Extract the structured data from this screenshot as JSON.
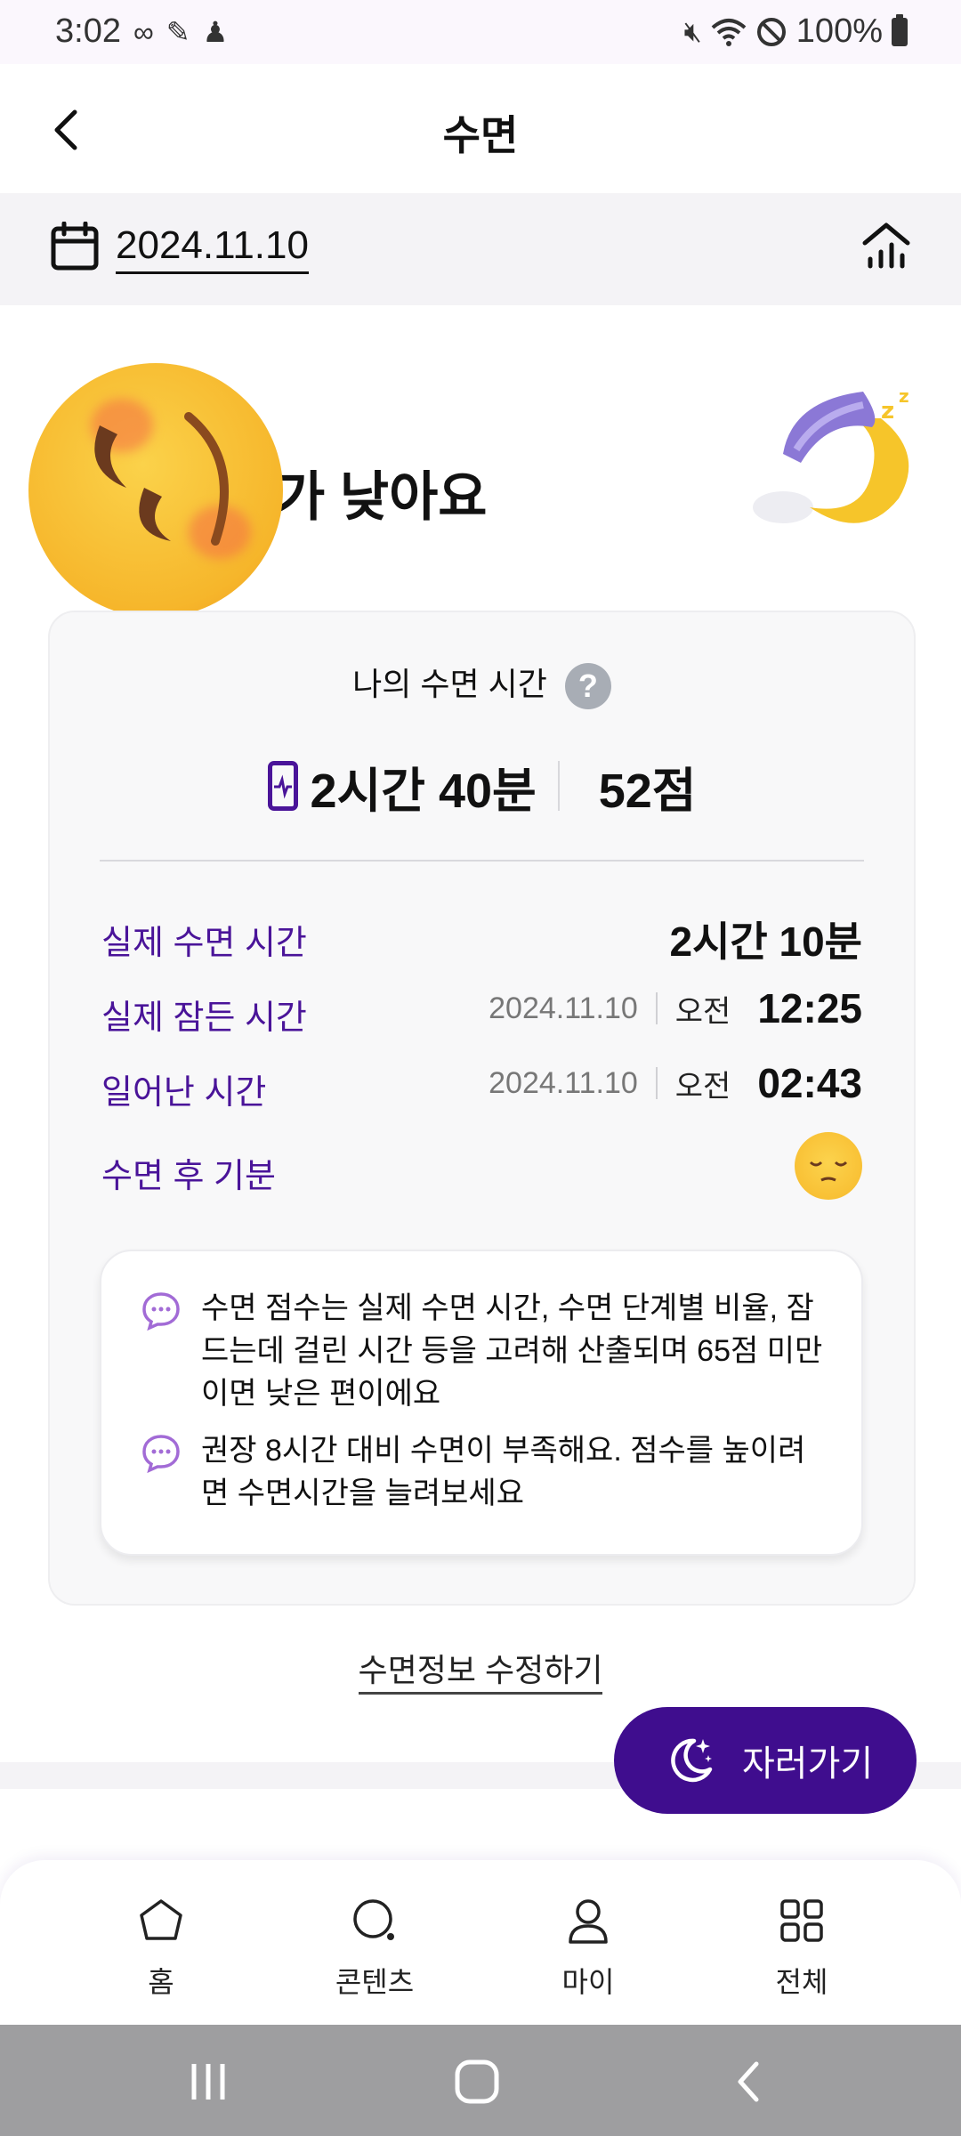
{
  "status_bar": {
    "time": "3:02",
    "battery": "100%"
  },
  "app_bar": {
    "title": "수면"
  },
  "date_bar": {
    "date": "2024.11.10"
  },
  "headline": {
    "text": "가 낮아요"
  },
  "card": {
    "title": "나의 수면 시간",
    "help_icon": "?",
    "summary_duration": "2시간 40분",
    "summary_score": "52점",
    "rows": [
      {
        "label": "실제 수면 시간",
        "value": "2시간 10분"
      },
      {
        "label": "실제 잠든 시간",
        "date": "2024.11.10",
        "ampm": "오전",
        "time": "12:25"
      },
      {
        "label": "일어난 시간",
        "date": "2024.11.10",
        "ampm": "오전",
        "time": "02:43"
      },
      {
        "label": "수면 후 기분",
        "mood_icon": "sleepy-face-icon"
      }
    ],
    "tips": [
      "수면 점수는 실제 수면 시간, 수면 단계별 비율, 잠드는데 걸린 시간 등을 고려해 산출되며 65점 미만이면 낮은 편이에요",
      "권장 8시간 대비 수면이 부족해요. 점수를 높이려면 수면시간을 늘려보세요"
    ]
  },
  "edit_link": "수면정보 수정하기",
  "sleep_button": "자러가기",
  "bottom_nav": [
    {
      "label": "홈",
      "icon": "home-icon"
    },
    {
      "label": "콘텐츠",
      "icon": "search-icon"
    },
    {
      "label": "마이",
      "icon": "person-icon"
    },
    {
      "label": "전체",
      "icon": "grid-icon"
    }
  ],
  "colors": {
    "accent": "#4a1499",
    "fab": "#3f0d8e"
  }
}
